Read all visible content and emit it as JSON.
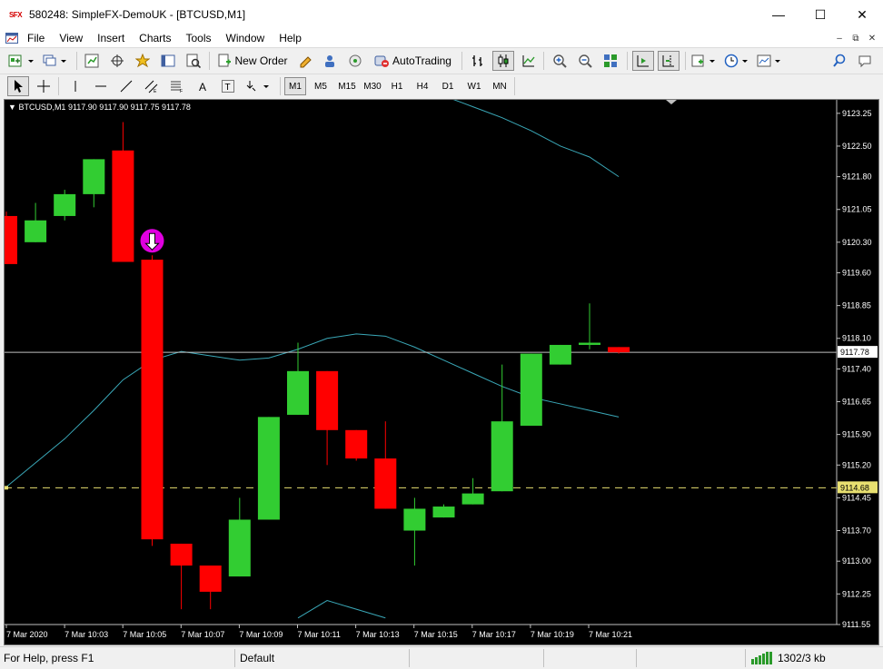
{
  "window": {
    "logo_text": "SFX",
    "title": "580248: SimpleFX-DemoUK - [BTCUSD,M1]",
    "minimize_glyph": "—",
    "maximize_glyph": "☐",
    "close_glyph": "✕"
  },
  "menu": {
    "items": [
      "File",
      "View",
      "Insert",
      "Charts",
      "Tools",
      "Window",
      "Help"
    ]
  },
  "toolbar": {
    "new_order_label": "New Order",
    "autotrading_label": "AutoTrading",
    "timeframes": [
      "M1",
      "M5",
      "M15",
      "M30",
      "H1",
      "H4",
      "D1",
      "W1",
      "MN"
    ]
  },
  "chart": {
    "header": "BTCUSD,M1  9117.90 9117.90 9117.75 9117.78",
    "background": "#000000",
    "bull_color": "#32cd32",
    "bear_color": "#ff0000",
    "current_price_label": "9117.78",
    "dashed_level_label": "9114.68"
  },
  "chart_data": {
    "type": "candlestick",
    "symbol": "BTCUSD",
    "timeframe": "M1",
    "ylim": [
      9111.55,
      9123.6
    ],
    "yticks": [
      9123.25,
      9122.5,
      9121.8,
      9121.05,
      9120.3,
      9119.6,
      9118.85,
      9118.1,
      9117.4,
      9116.65,
      9115.9,
      9115.2,
      9114.45,
      9113.7,
      9113.0,
      9112.25,
      9111.55
    ],
    "xticks": [
      "7 Mar 2020",
      "7 Mar 10:03",
      "7 Mar 10:05",
      "7 Mar 10:07",
      "7 Mar 10:09",
      "7 Mar 10:11",
      "7 Mar 10:13",
      "7 Mar 10:15",
      "7 Mar 10:17",
      "7 Mar 10:19",
      "7 Mar 10:21"
    ],
    "candles": [
      {
        "o": 9120.9,
        "h": 9121.0,
        "l": 9119.8,
        "c": 9119.8
      },
      {
        "o": 9120.3,
        "h": 9121.2,
        "l": 9120.3,
        "c": 9120.8
      },
      {
        "o": 9120.9,
        "h": 9121.5,
        "l": 9120.8,
        "c": 9121.4
      },
      {
        "o": 9121.4,
        "h": 9122.2,
        "l": 9121.1,
        "c": 9122.2
      },
      {
        "o": 9122.4,
        "h": 9123.05,
        "l": 9120.0,
        "c": 9119.85
      },
      {
        "o": 9119.9,
        "h": 9120.0,
        "l": 9113.35,
        "c": 9113.5
      },
      {
        "o": 9113.4,
        "h": 9113.1,
        "l": 9111.9,
        "c": 9112.9
      },
      {
        "o": 9112.9,
        "h": 9112.9,
        "l": 9111.9,
        "c": 9112.3
      },
      {
        "o": 9112.65,
        "h": 9114.45,
        "l": 9112.65,
        "c": 9113.95
      },
      {
        "o": 9113.95,
        "h": 9116.3,
        "l": 9113.95,
        "c": 9116.3
      },
      {
        "o": 9116.35,
        "h": 9118.0,
        "l": 9116.35,
        "c": 9117.35
      },
      {
        "o": 9117.35,
        "h": 9117.35,
        "l": 9115.2,
        "c": 9116.0
      },
      {
        "o": 9116.0,
        "h": 9116.0,
        "l": 9115.3,
        "c": 9115.35
      },
      {
        "o": 9115.35,
        "h": 9116.2,
        "l": 9114.2,
        "c": 9114.2
      },
      {
        "o": 9113.7,
        "h": 9114.45,
        "l": 9112.9,
        "c": 9114.2
      },
      {
        "o": 9114.0,
        "h": 9114.3,
        "l": 9114.0,
        "c": 9114.25
      },
      {
        "o": 9114.3,
        "h": 9114.9,
        "l": 9114.3,
        "c": 9114.55
      },
      {
        "o": 9114.6,
        "h": 9117.5,
        "l": 9114.6,
        "c": 9116.2
      },
      {
        "o": 9116.1,
        "h": 9117.75,
        "l": 9116.1,
        "c": 9117.75
      },
      {
        "o": 9117.5,
        "h": 9117.95,
        "l": 9117.5,
        "c": 9117.95
      },
      {
        "o": 9117.95,
        "h": 9118.9,
        "l": 9117.85,
        "c": 9118.0
      },
      {
        "o": 9117.9,
        "h": 9117.9,
        "l": 9117.75,
        "c": 9117.78
      }
    ],
    "upper_band": [
      null,
      null,
      null,
      null,
      null,
      null,
      null,
      null,
      null,
      null,
      null,
      null,
      null,
      null,
      null,
      9123.65,
      9123.4,
      9123.15,
      9122.85,
      9122.5,
      9122.25,
      9121.8
    ],
    "middle_band": [
      9114.7,
      9115.25,
      9115.8,
      9116.45,
      9117.15,
      9117.6,
      9117.8,
      9117.7,
      9117.6,
      9117.65,
      9117.85,
      9118.1,
      9118.2,
      9118.15,
      9117.9,
      9117.6,
      9117.3,
      9117.0,
      9116.75,
      9116.6,
      9116.45,
      9116.3
    ],
    "lower_band": [
      null,
      null,
      null,
      null,
      null,
      null,
      null,
      null,
      null,
      null,
      9111.7,
      9112.1,
      9111.9,
      9111.7,
      null,
      null,
      null,
      null,
      null,
      null,
      null,
      null
    ],
    "current_price": 9117.78,
    "dashed_level": 9114.68,
    "sell_arrow_candle_index": 5
  },
  "statusbar": {
    "help": "For Help, press F1",
    "profile": "Default",
    "traffic": "1302/3 kb"
  }
}
